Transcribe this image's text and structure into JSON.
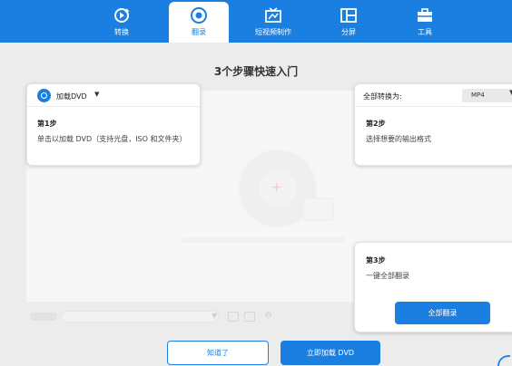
{
  "nav": {
    "items": [
      {
        "label": "转换",
        "icon": "convert-icon"
      },
      {
        "label": "翻录",
        "icon": "rip-disc-icon"
      },
      {
        "label": "短视频制作",
        "icon": "video-tv-icon"
      },
      {
        "label": "分屏",
        "icon": "split-screen-icon"
      },
      {
        "label": "工具",
        "icon": "toolbox-icon"
      }
    ],
    "active_index": 1
  },
  "heading": "3个步骤快速入门",
  "load": {
    "label": "加载DVD",
    "caret": "▼"
  },
  "convert_all": {
    "label": "全部转换为:",
    "format": "MP4",
    "caret": "▼"
  },
  "steps": [
    {
      "title": "第1步",
      "desc": "单击以加载 DVD（支持光盘，ISO 和文件夹）"
    },
    {
      "title": "第2步",
      "desc": "选择想要的输出格式"
    },
    {
      "title": "第3步",
      "desc": "一键全部翻录"
    }
  ],
  "buttons": {
    "rip_all": "全部翻录",
    "got_it": "知道了",
    "load_dvd_now": "立即加载 DVD"
  },
  "background": {
    "plus": "+",
    "gear": "⚙"
  },
  "colors": {
    "accent": "#1a7fe0"
  }
}
